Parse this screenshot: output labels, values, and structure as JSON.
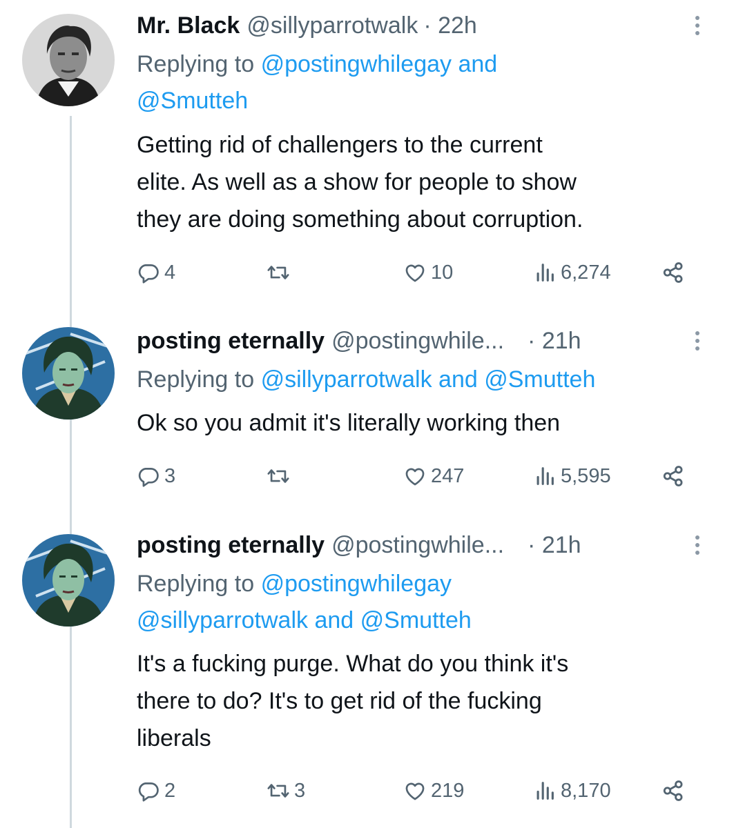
{
  "tweets": [
    {
      "name": "Mr. Black",
      "handle": "@sillyparrotwalk",
      "time": "· 22h",
      "reply_prefix": "Replying to",
      "reply_mentions_line1": "@postingwhilegay",
      "reply_and1": "and",
      "reply_mentions_line2": "@Smutteh",
      "text_lines": [
        "Getting rid of challengers to the current",
        "elite.  As well as a show for people to show",
        "they are doing something about corruption."
      ],
      "stats": {
        "replies": "4",
        "retweets": "",
        "likes": "10",
        "views": "6,274"
      }
    },
    {
      "name": "posting eternally",
      "handle": "@postingwhile...",
      "time": "· 21h",
      "reply_prefix": "Replying to",
      "reply_m1": "@sillyparrotwalk",
      "reply_and": "and",
      "reply_m2": "@Smutteh",
      "text_lines": [
        "Ok so you admit it's literally working then"
      ],
      "stats": {
        "replies": "3",
        "retweets": "",
        "likes": "247",
        "views": "5,595"
      }
    },
    {
      "name": "posting eternally",
      "handle": "@postingwhile...",
      "time": "· 21h",
      "reply_prefix": "Replying to",
      "reply_m1": "@postingwhilegay",
      "reply_m2": "@sillyparrotwalk",
      "reply_and": "and",
      "reply_m3": "@Smutteh",
      "text_lines": [
        "It's a fucking purge. What do you think it's",
        "there to do? It's to get rid of the fucking",
        "liberals"
      ],
      "stats": {
        "replies": "2",
        "retweets": "3",
        "likes": "219",
        "views": "8,170"
      }
    }
  ],
  "icons": {
    "reply": "reply-icon",
    "retweet": "retweet-icon",
    "like": "heart-icon",
    "views": "views-icon",
    "share": "share-icon",
    "more": "more-icon"
  },
  "colors": {
    "text": "#0f1419",
    "secondary": "#536471",
    "link": "#1d9bf0",
    "thread_line": "#cfd9de"
  }
}
